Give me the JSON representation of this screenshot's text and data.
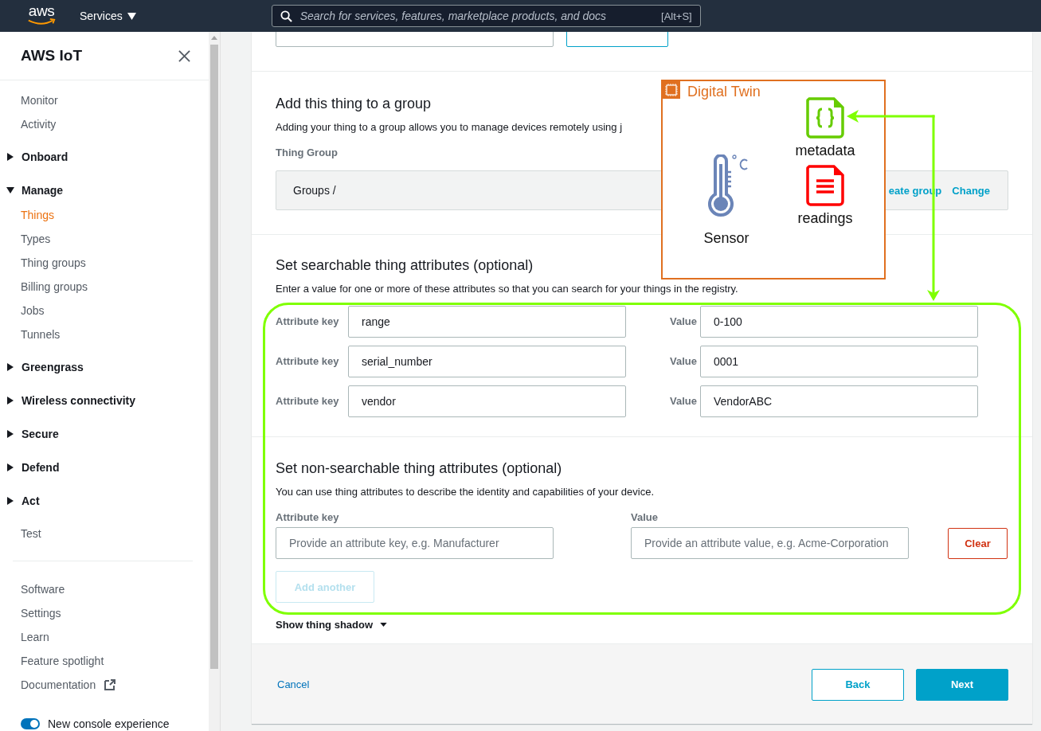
{
  "header": {
    "logo": "aws",
    "services_menu": "Services",
    "search": {
      "placeholder": "Search for services, features, marketplace products, and docs",
      "shortcut": "[Alt+S]"
    }
  },
  "sidebar": {
    "title": "AWS IoT",
    "items": [
      {
        "label": "Monitor",
        "kind": "link",
        "selected": false
      },
      {
        "label": "Activity",
        "kind": "link",
        "selected": false
      },
      {
        "label": "Onboard",
        "kind": "section",
        "selected": false,
        "expanded": false
      },
      {
        "label": "Manage",
        "kind": "section",
        "selected": false,
        "expanded": true,
        "children": [
          {
            "label": "Things",
            "selected": true
          },
          {
            "label": "Types",
            "selected": false
          },
          {
            "label": "Thing groups",
            "selected": false
          },
          {
            "label": "Billing groups",
            "selected": false
          },
          {
            "label": "Jobs",
            "selected": false
          },
          {
            "label": "Tunnels",
            "selected": false
          }
        ]
      },
      {
        "label": "Greengrass",
        "kind": "section",
        "selected": false,
        "expanded": false
      },
      {
        "label": "Wireless connectivity",
        "kind": "section",
        "selected": false,
        "expanded": false
      },
      {
        "label": "Secure",
        "kind": "section",
        "selected": false,
        "expanded": false
      },
      {
        "label": "Defend",
        "kind": "section",
        "selected": false,
        "expanded": false
      },
      {
        "label": "Act",
        "kind": "section",
        "selected": false,
        "expanded": false
      },
      {
        "label": "Test",
        "kind": "link",
        "selected": false
      }
    ],
    "footer_links": [
      {
        "label": "Software",
        "kind": "link"
      },
      {
        "label": "Settings",
        "kind": "link"
      },
      {
        "label": "Learn",
        "kind": "link"
      },
      {
        "label": "Feature spotlight",
        "kind": "link"
      },
      {
        "label": "Documentation",
        "kind": "external"
      }
    ],
    "toggle": {
      "label": "New console experience",
      "on": true
    }
  },
  "form": {
    "group": {
      "title": "Add this thing to a group",
      "description": "Adding your thing to a group allows you to manage devices remotely using j",
      "label": "Thing Group",
      "breadcrumb": "Groups /",
      "links": [
        "eate group",
        "Change"
      ]
    },
    "searchable": {
      "title": "Set searchable thing attributes (optional)",
      "description": "Enter a value for one or more of these attributes so that you can search for your things in the registry.",
      "rows": [
        {
          "key_label": "Attribute key",
          "key": "range",
          "value_label": "Value",
          "value": "0-100"
        },
        {
          "key_label": "Attribute key",
          "key": "serial_number",
          "value_label": "Value",
          "value": "0001"
        },
        {
          "key_label": "Attribute key",
          "key": "vendor",
          "value_label": "Value",
          "value": "VendorABC"
        }
      ]
    },
    "non_searchable": {
      "title": "Set non-searchable thing attributes (optional)",
      "description": "You can use thing attributes to describe the identity and capabilities of your device.",
      "key_label": "Attribute key",
      "value_label": "Value",
      "key_placeholder": "Provide an attribute key, e.g. Manufacturer",
      "value_placeholder": "Provide an attribute value, e.g. Acme-Corporation",
      "clear_button": "Clear",
      "add_button": {
        "label": "Add another",
        "disabled": true
      }
    },
    "shadow_toggle": "Show thing shadow",
    "footer": {
      "cancel": "Cancel",
      "back": "Back",
      "next": "Next"
    }
  },
  "diagram": {
    "title": "Digital Twin",
    "nodes": [
      {
        "kind": "thermometer",
        "label": "Sensor"
      },
      {
        "kind": "json",
        "label": "metadata"
      },
      {
        "kind": "document",
        "label": "readings"
      }
    ]
  }
}
